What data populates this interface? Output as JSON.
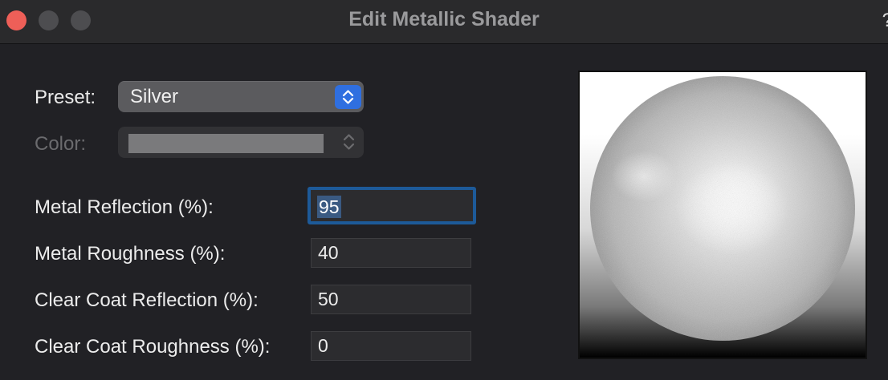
{
  "window": {
    "title": "Edit Metallic Shader",
    "help_label": "?"
  },
  "form": {
    "preset_label": "Preset:",
    "preset_value": "Silver",
    "color_label": "Color:",
    "color_value": "#7a7a7c",
    "metal_reflection_label": "Metal Reflection (%):",
    "metal_reflection_value": "95",
    "metal_roughness_label": "Metal Roughness (%):",
    "metal_roughness_value": "40",
    "clear_coat_reflection_label": "Clear Coat Reflection (%):",
    "clear_coat_reflection_value": "50",
    "clear_coat_roughness_label": "Clear Coat Roughness (%):",
    "clear_coat_roughness_value": "0"
  },
  "colors": {
    "accent": "#2f6fe0",
    "focus_ring": "#1d5a99",
    "close": "#ee5f58"
  }
}
